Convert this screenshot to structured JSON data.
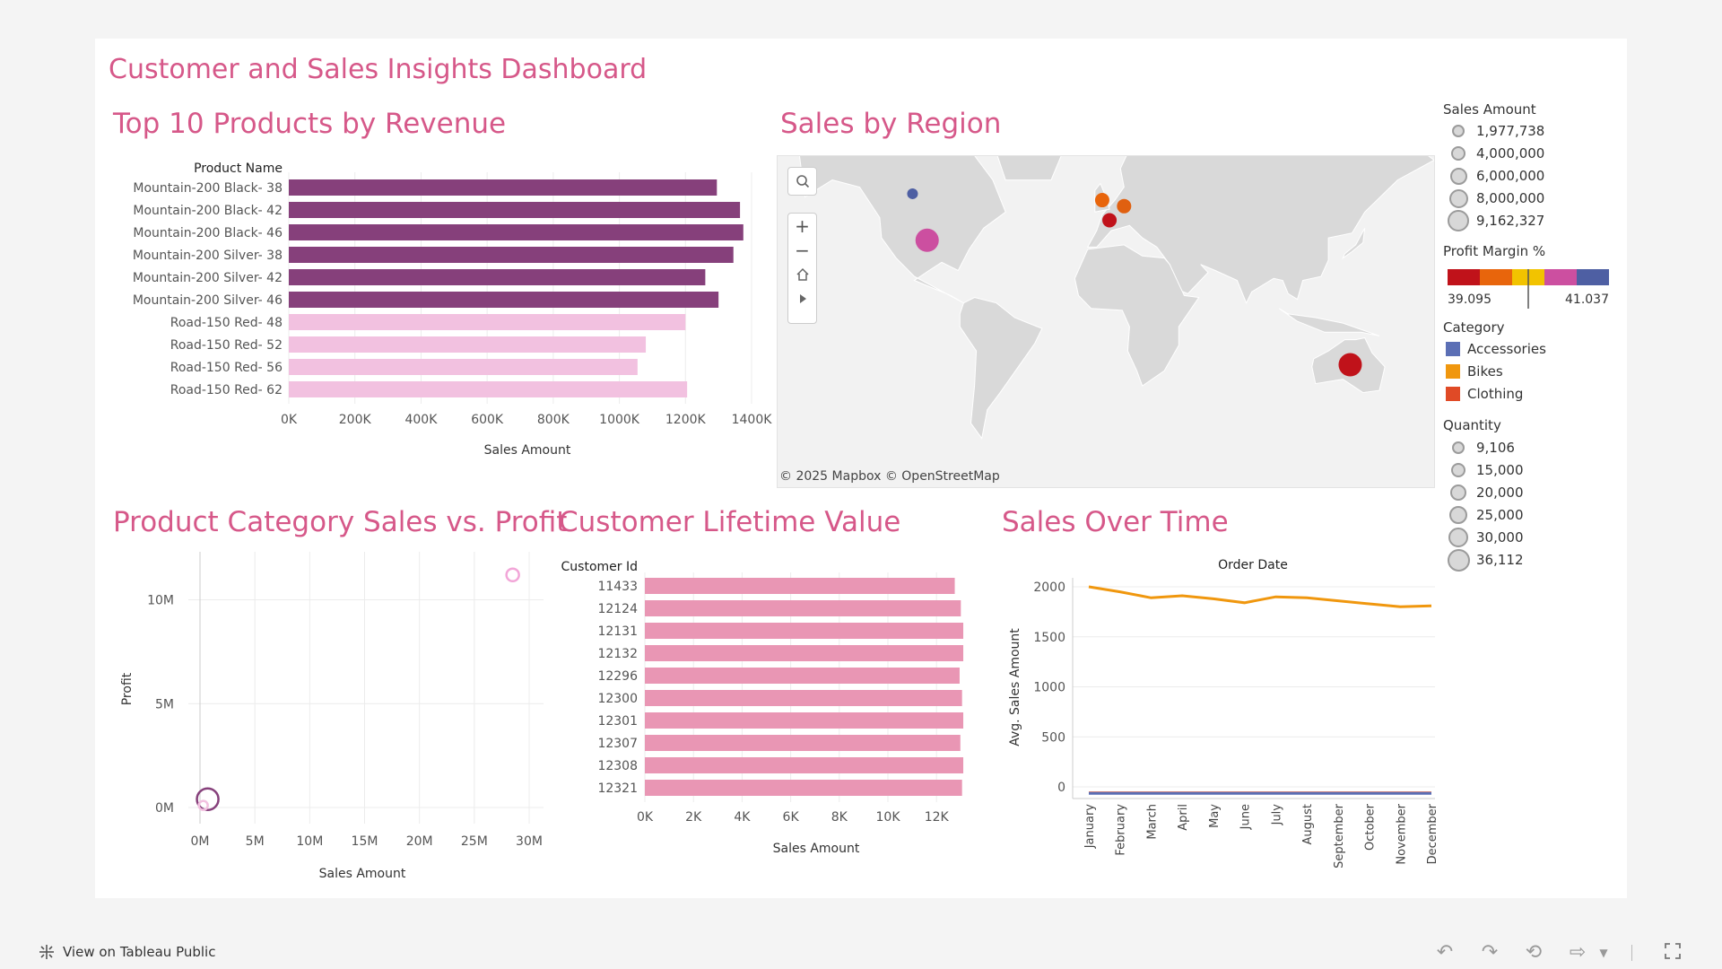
{
  "dashboard_title": "Customer and Sales Insights Dashboard",
  "sections": {
    "top_products": "Top 10 Products by Revenue",
    "sales_by_region": "Sales by Region",
    "category_sales_profit": "Product Category Sales vs. Profit",
    "customer_ltv": "Customer Lifetime Value",
    "sales_over_time": "Sales Over Time"
  },
  "map": {
    "attribution": "© 2025 Mapbox  © OpenStreetMap",
    "controls": [
      "search-icon",
      "zoom-in-icon",
      "zoom-out-icon",
      "home-icon",
      "play-icon"
    ],
    "points": [
      {
        "region": "Canada",
        "lon": -106,
        "lat": 56,
        "color": "#4e5fa3",
        "size": "small"
      },
      {
        "region": "United States",
        "lon": -98,
        "lat": 39,
        "color": "#cc4fa0",
        "size": "large"
      },
      {
        "region": "United Kingdom",
        "lon": -2,
        "lat": 54,
        "color": "#e8650c",
        "size": "medium"
      },
      {
        "region": "Germany",
        "lon": 10,
        "lat": 52,
        "color": "#e06010",
        "size": "medium"
      },
      {
        "region": "France",
        "lon": 2,
        "lat": 47,
        "color": "#c0121a",
        "size": "medium"
      },
      {
        "region": "Australia",
        "lon": 134,
        "lat": -25,
        "color": "#c0121a",
        "size": "large"
      }
    ]
  },
  "legend": {
    "sales_amount": {
      "title": "Sales Amount",
      "items": [
        "1,977,738",
        "4,000,000",
        "6,000,000",
        "8,000,000",
        "9,162,327"
      ]
    },
    "profit_margin": {
      "title": "Profit Margin %",
      "min": "39.095",
      "max": "41.037",
      "colors": [
        "#c0121a",
        "#e8650c",
        "#f2c300",
        "#cc4fa0",
        "#4e5fa3"
      ]
    },
    "category": {
      "title": "Category",
      "items": [
        {
          "label": "Accessories",
          "color": "#5b6fb5"
        },
        {
          "label": "Bikes",
          "color": "#f0970e"
        },
        {
          "label": "Clothing",
          "color": "#e04a26"
        }
      ]
    },
    "quantity": {
      "title": "Quantity",
      "items": [
        "9,106",
        "15,000",
        "20,000",
        "25,000",
        "30,000",
        "36,112"
      ]
    }
  },
  "footer": {
    "link": "View on Tableau Public"
  },
  "toolbar": [
    "undo-icon",
    "redo-icon",
    "revert-icon",
    "share-icon",
    "dropdown-icon",
    "fullscreen-icon"
  ],
  "chart_data": [
    {
      "id": "top_products",
      "type": "bar",
      "orientation": "horizontal",
      "dimension_label": "Product Name",
      "xlabel": "Sales Amount",
      "xlim": [
        0,
        1400000
      ],
      "x_ticks": [
        "0K",
        "200K",
        "400K",
        "600K",
        "800K",
        "1000K",
        "1200K",
        "1400K"
      ],
      "categories": [
        "Mountain-200 Black- 38",
        "Mountain-200 Black- 42",
        "Mountain-200 Black- 46",
        "Mountain-200 Silver- 38",
        "Mountain-200 Silver- 42",
        "Mountain-200 Silver- 46",
        "Road-150 Red- 48",
        "Road-150 Red- 52",
        "Road-150 Red- 56",
        "Road-150 Red- 62"
      ],
      "values": [
        1295000,
        1365000,
        1375000,
        1345000,
        1260000,
        1300000,
        1200000,
        1080000,
        1055000,
        1205000
      ],
      "colors": [
        "#86407b",
        "#86407b",
        "#86407b",
        "#86407b",
        "#86407b",
        "#86407b",
        "#f2c1e0",
        "#f2c1e0",
        "#f2c1e0",
        "#f2c1e0"
      ]
    },
    {
      "id": "category_sales_profit",
      "type": "scatter",
      "xlabel": "Sales Amount",
      "ylabel": "Profit",
      "xlim": [
        0,
        30000000
      ],
      "ylim": [
        0,
        12000000
      ],
      "x_ticks": [
        "0M",
        "5M",
        "10M",
        "15M",
        "20M",
        "25M",
        "30M"
      ],
      "y_ticks": [
        "0M",
        "5M",
        "10M"
      ],
      "points": [
        {
          "x": 28500000,
          "y": 11200000,
          "color": "#f2a6d8",
          "size": "small"
        },
        {
          "x": 700000,
          "y": 400000,
          "color": "#86407b",
          "size": "large"
        },
        {
          "x": 300000,
          "y": 100000,
          "color": "#f2c1e0",
          "size": "tiny"
        }
      ]
    },
    {
      "id": "customer_ltv",
      "type": "bar",
      "orientation": "horizontal",
      "dimension_label": "Customer Id",
      "xlabel": "Sales Amount",
      "xlim": [
        0,
        13000
      ],
      "x_ticks": [
        "0K",
        "2K",
        "4K",
        "6K",
        "8K",
        "10K",
        "12K"
      ],
      "categories": [
        "11433",
        "12124",
        "12131",
        "12132",
        "12296",
        "12300",
        "12301",
        "12307",
        "12308",
        "12321"
      ],
      "values": [
        12750,
        13000,
        13100,
        13100,
        12950,
        13050,
        13100,
        12980,
        13100,
        13050
      ],
      "color": "#e996b4"
    },
    {
      "id": "sales_over_time",
      "type": "line",
      "title": "Order Date",
      "ylabel": "Avg. Sales Amount",
      "ylim": [
        0,
        2000
      ],
      "y_ticks": [
        "0",
        "500",
        "1000",
        "1500",
        "2000"
      ],
      "categories": [
        "January",
        "February",
        "March",
        "April",
        "May",
        "June",
        "July",
        "August",
        "September",
        "October",
        "November",
        "December"
      ],
      "series": [
        {
          "color": "#f0970e",
          "values": [
            2000,
            1950,
            1890,
            1910,
            1880,
            1840,
            1900,
            1890,
            1860,
            1830,
            1800,
            1810
          ]
        },
        {
          "color": "#e04a26",
          "values": [
            -60,
            -60,
            -60,
            -60,
            -60,
            -60,
            -60,
            -60,
            -60,
            -60,
            -60,
            -60
          ]
        },
        {
          "color": "#5b6fb5",
          "values": [
            -65,
            -65,
            -65,
            -65,
            -65,
            -65,
            -65,
            -65,
            -65,
            -65,
            -65,
            -65
          ]
        }
      ]
    }
  ]
}
